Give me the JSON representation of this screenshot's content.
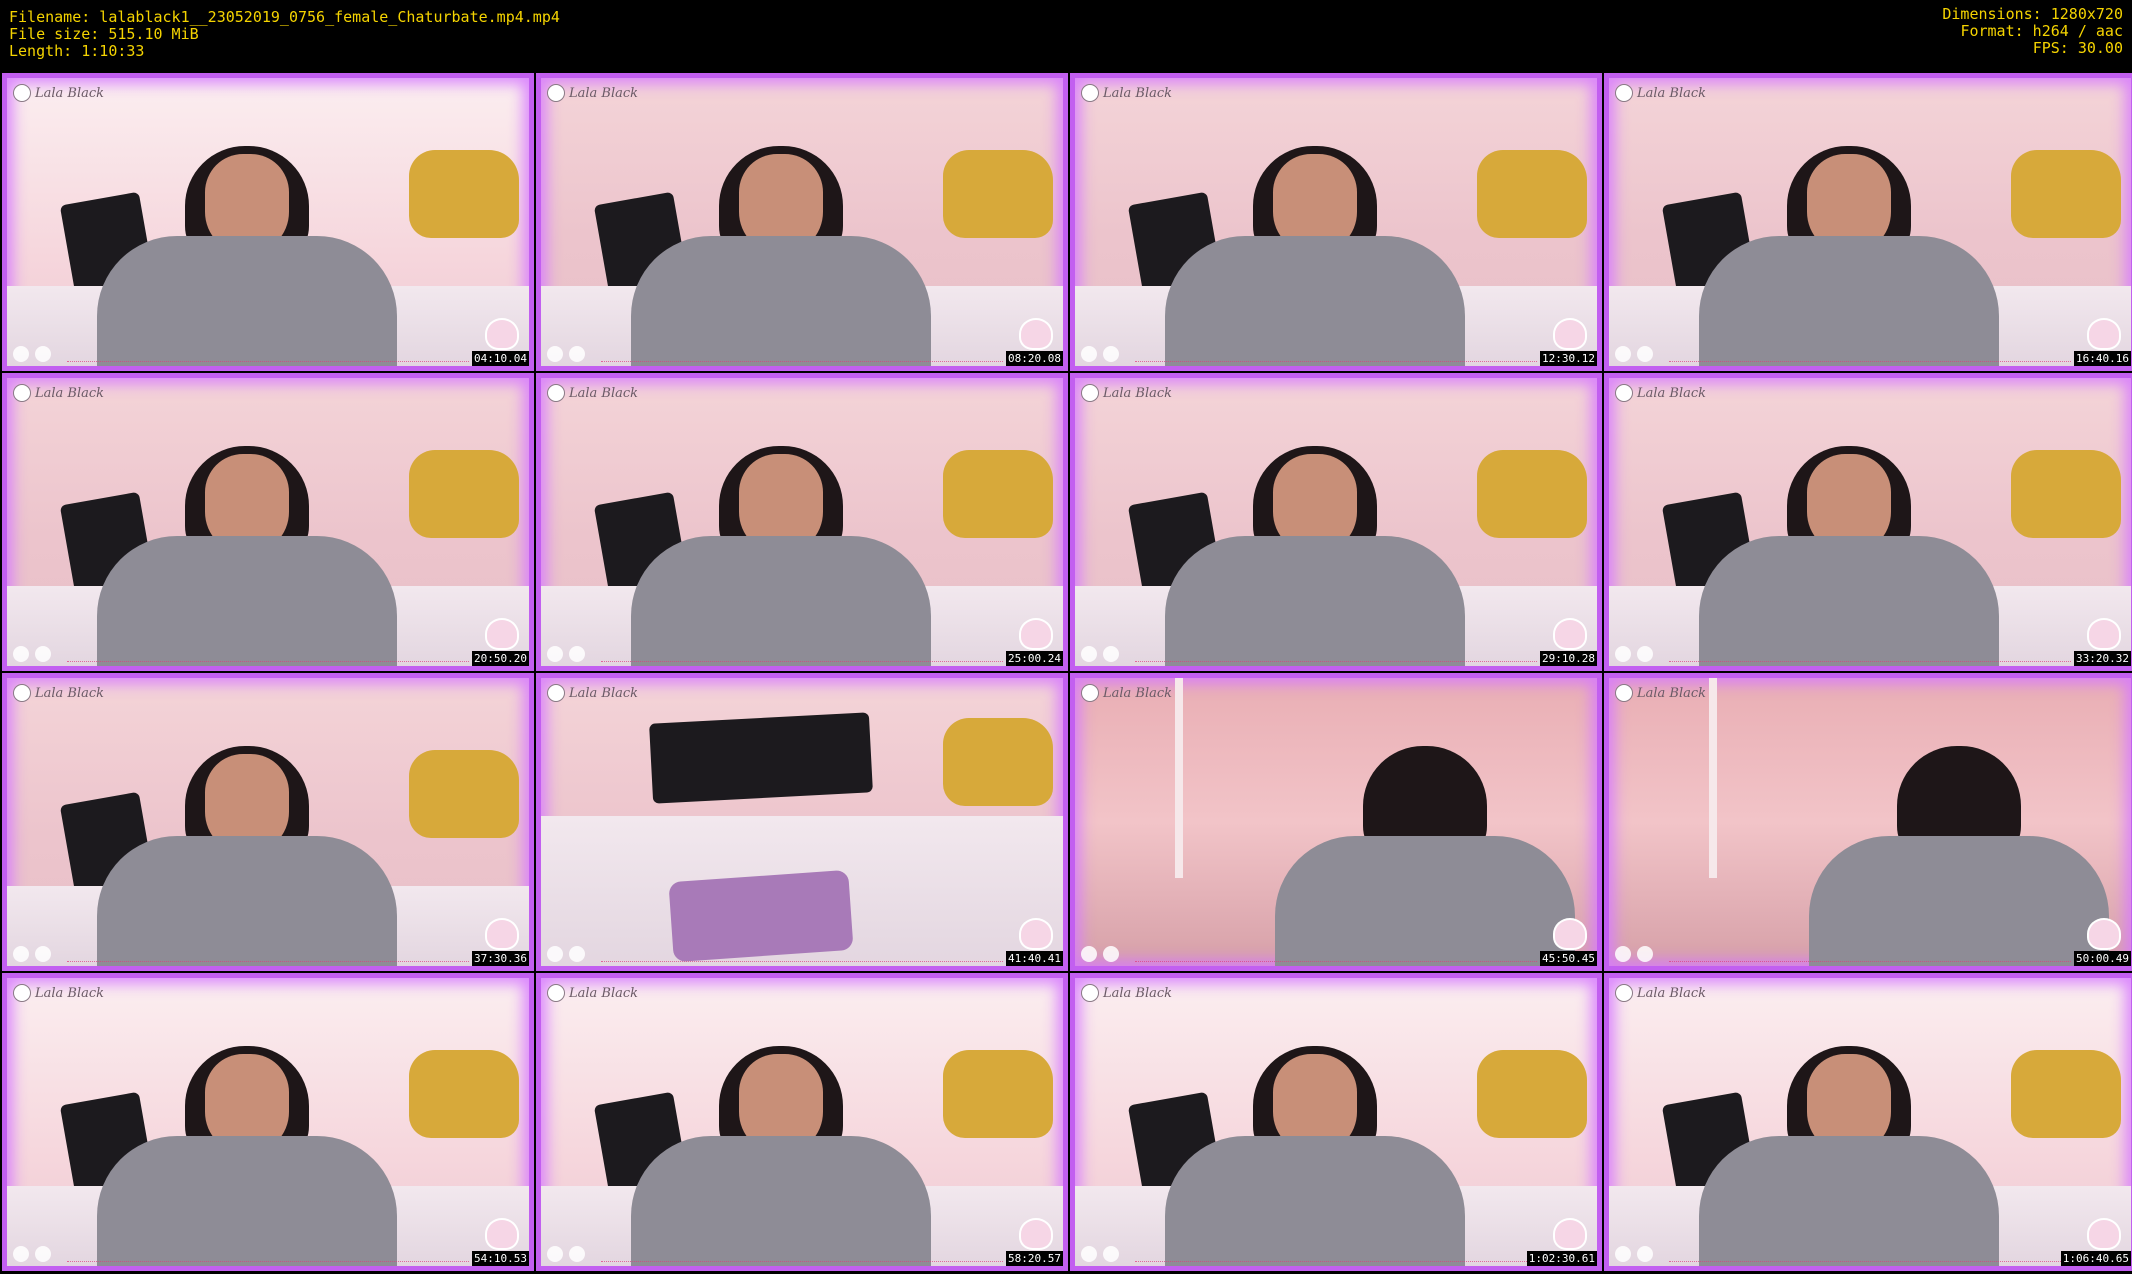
{
  "header": {
    "filename": "Filename: lalablack1__23052019_0756_female_Chaturbate.mp4.mp4",
    "filesize": "File size: 515.10 MiB",
    "length": "Length: 1:10:33",
    "dimensions": "Dimensions: 1280x720",
    "format": "Format: h264 / aac",
    "fps": "FPS: 30.00"
  },
  "thumbnails": [
    {
      "time": "04:10.04",
      "scene": "bright"
    },
    {
      "time": "08:20.08",
      "scene": "normal"
    },
    {
      "time": "12:30.12",
      "scene": "normal"
    },
    {
      "time": "16:40.16",
      "scene": "normal"
    },
    {
      "time": "20:50.20",
      "scene": "normal"
    },
    {
      "time": "25:00.24",
      "scene": "normal"
    },
    {
      "time": "29:10.28",
      "scene": "normal"
    },
    {
      "time": "33:20.32",
      "scene": "normal"
    },
    {
      "time": "37:30.36",
      "scene": "normal"
    },
    {
      "time": "41:40.41",
      "scene": "empty"
    },
    {
      "time": "45:50.45",
      "scene": "room"
    },
    {
      "time": "50:00.49",
      "scene": "room"
    },
    {
      "time": "54:10.53",
      "scene": "bright"
    },
    {
      "time": "58:20.57",
      "scene": "bright"
    },
    {
      "time": "1:02:30.61",
      "scene": "bright"
    },
    {
      "time": "1:06:40.65",
      "scene": "bright"
    }
  ],
  "logo_text": "Lala Black",
  "colors": {
    "header_text": "#f5d400",
    "border": "#c25ff0",
    "background": "#000000"
  }
}
